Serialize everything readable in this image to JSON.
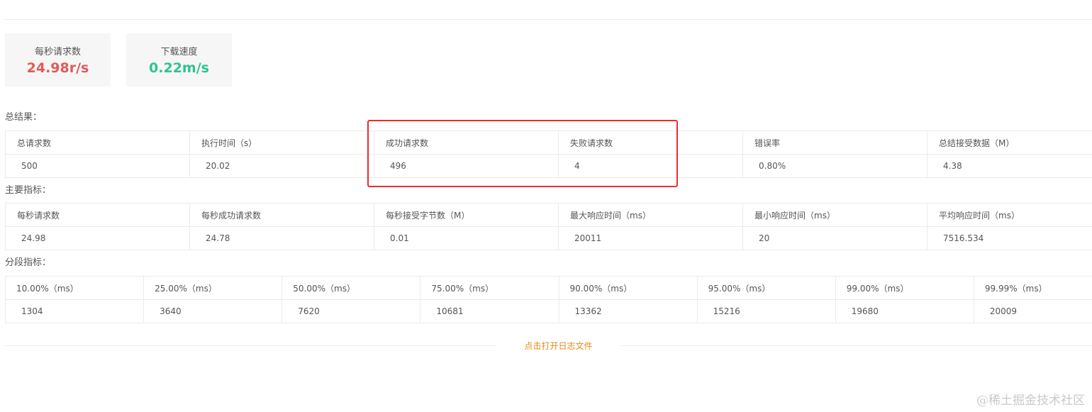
{
  "stats": [
    {
      "label": "每秒请求数",
      "value": "24.98r/s",
      "color": "#e05a5a"
    },
    {
      "label": "下载速度",
      "value": "0.22m/s",
      "color": "#2fc392"
    }
  ],
  "summary": {
    "title": "总结果：",
    "headers": [
      "总请求数",
      "执行时间（s）",
      "成功请求数",
      "失败请求数",
      "错误率",
      "总结接受数据（M）"
    ],
    "values": [
      "500",
      "20.02",
      "496",
      "4",
      "0.80%",
      "4.38"
    ]
  },
  "main_metrics": {
    "title": "主要指标：",
    "headers": [
      "每秒请求数",
      "每秒成功请求数",
      "每秒接受字节数（M）",
      "最大响应时间（ms）",
      "最小响应时间（ms）",
      "平均响应时间（ms）"
    ],
    "values": [
      "24.98",
      "24.78",
      "0.01",
      "20011",
      "20",
      "7516.534"
    ]
  },
  "percentiles": {
    "title": "分段指标：",
    "headers": [
      "10.00%（ms）",
      "25.00%（ms）",
      "50.00%（ms）",
      "75.00%（ms）",
      "90.00%（ms）",
      "95.00%（ms）",
      "99.00%（ms）",
      "99.99%（ms）"
    ],
    "values": [
      "1304",
      "3640",
      "7620",
      "10681",
      "13362",
      "15216",
      "19680",
      "20009"
    ]
  },
  "log_link": "点击打开日志文件",
  "watermark": "@稀土掘金技术社区",
  "colors": {
    "highlight": "#e62e2e",
    "link": "#e6891c"
  }
}
